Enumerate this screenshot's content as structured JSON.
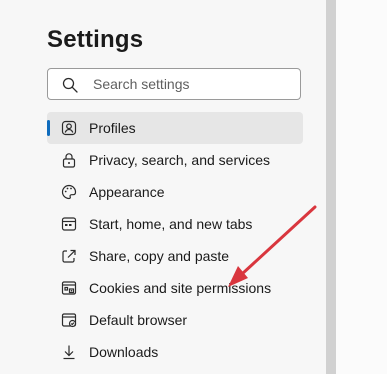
{
  "settings": {
    "title": "Settings",
    "search_placeholder": "Search settings",
    "search_value": ""
  },
  "nav": {
    "items": [
      {
        "label": "Profiles",
        "icon": "profile-icon",
        "selected": true
      },
      {
        "label": "Privacy, search, and services",
        "icon": "lock-icon",
        "selected": false
      },
      {
        "label": "Appearance",
        "icon": "palette-icon",
        "selected": false
      },
      {
        "label": "Start, home, and new tabs",
        "icon": "new-tab-icon",
        "selected": false
      },
      {
        "label": "Share, copy and paste",
        "icon": "share-icon",
        "selected": false
      },
      {
        "label": "Cookies and site permissions",
        "icon": "site-permissions-icon",
        "selected": false
      },
      {
        "label": "Default browser",
        "icon": "browser-icon",
        "selected": false
      },
      {
        "label": "Downloads",
        "icon": "download-icon",
        "selected": false
      }
    ]
  },
  "colors": {
    "accent": "#0f6cbd",
    "annotation_arrow": "#d9363e",
    "selected_background": "#e6e6e6"
  }
}
